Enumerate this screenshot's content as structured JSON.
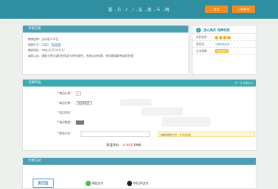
{
  "header": {
    "title": "喜 ,方 ,t ,l ,证 ,发 ,卡 ,网",
    "home_button": "首页",
    "query_button": "订单查询"
  },
  "seller_info": {
    "section_title": "商家信息",
    "rows": [
      "商铺名称：自动发卡平台",
      "商家Q Q：1220",
      "商家网址：http://127.0.0.1/",
      "商家公告：提取卡密后请尽快验证卡密有效性，系统自动处理，有问题请联系商家处理"
    ],
    "qq_badge": "QQ交谈"
  },
  "promise": {
    "title": "放心购买  保障有我",
    "rows": [
      {
        "label": "卖家信用："
      },
      {
        "label": "保证金：",
        "value": "已缴纳保证金"
      },
      {
        "label": "支付保障：",
        "value": "安全支付"
      }
    ]
  },
  "goods": {
    "section_title": "选择商品",
    "head_right": "扫一扫 手机支付",
    "fields": {
      "category_label": "商品分类：",
      "category_value": "▾",
      "name_label": "商品名称：",
      "name_value": "请选择商品",
      "stock_label": "商品库存：",
      "quantity_label": "购买数量：",
      "contact_label": "联系方式："
    },
    "hint": "请填写联系方式",
    "hint_warn": "! 未查询重要",
    "price_label": "商品单价：",
    "price_value": "0.00元",
    "price_unit": "RMB"
  },
  "payment": {
    "section_title": "付款方式",
    "alipay": "支付宝",
    "wechat": "微信支付",
    "qq": "QQ扫码支付"
  }
}
